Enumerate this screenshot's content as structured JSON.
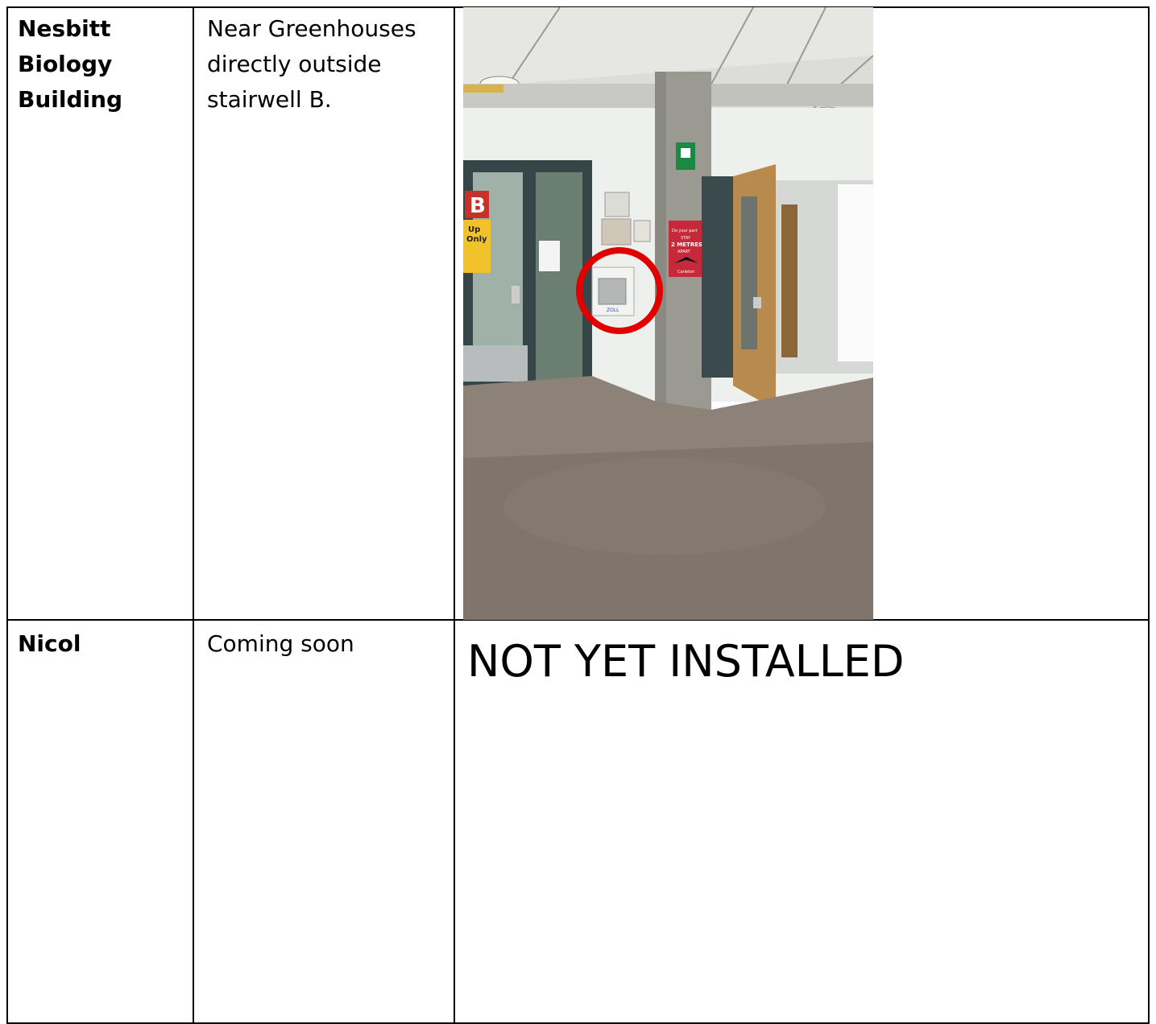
{
  "rows": [
    {
      "building": [
        "Nesbitt",
        "Biology",
        "Building"
      ],
      "location": [
        "Near Greenhouses",
        "directly outside",
        "stairwell B."
      ]
    },
    {
      "building": [
        "Nicol"
      ],
      "location": [
        "Coming soon"
      ],
      "status": "NOT YET INSTALLED"
    }
  ],
  "photo": {
    "stair_sign_letter": "B",
    "stair_sign_text": [
      "Up",
      "Only"
    ],
    "poster_text": [
      "Do your part",
      "STAY",
      "2 METRES",
      "APART",
      "Carleton"
    ],
    "cabinet_brand": "ZOLL",
    "highlight_color": "#e00000"
  }
}
